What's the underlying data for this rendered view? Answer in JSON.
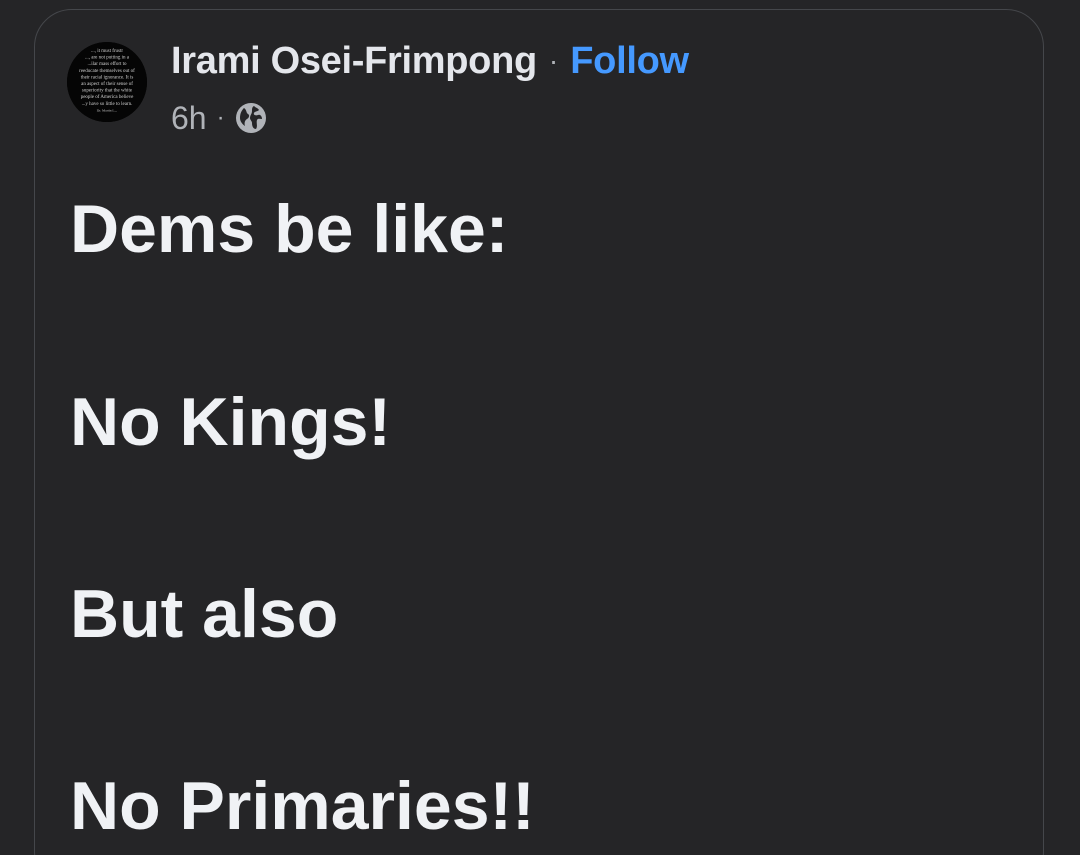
{
  "post": {
    "author_name": "Irami Osei-Frimpong",
    "separator": "·",
    "follow_label": "Follow",
    "timestamp": "6h",
    "meta_separator": "·",
    "audience_icon": "globe-icon",
    "avatar_quote_lines": [
      "..., it must frustr",
      "..., are not putting in a",
      "...ilar mass effort to",
      "reeducate themselves out of",
      "their racial ignorance. It is",
      "an aspect of their sense of",
      "superiority that the white",
      "people of America believe",
      "...y have so little to learn.",
      "Dr. Martin L..."
    ],
    "lines": [
      "Dems be like:",
      "No Kings!",
      "But also",
      "No Primaries!!"
    ]
  },
  "colors": {
    "background": "#252527",
    "card_border": "#45474b",
    "primary_text": "#e4e6eb",
    "secondary_text": "#b0b3b8",
    "link": "#4599ff"
  }
}
